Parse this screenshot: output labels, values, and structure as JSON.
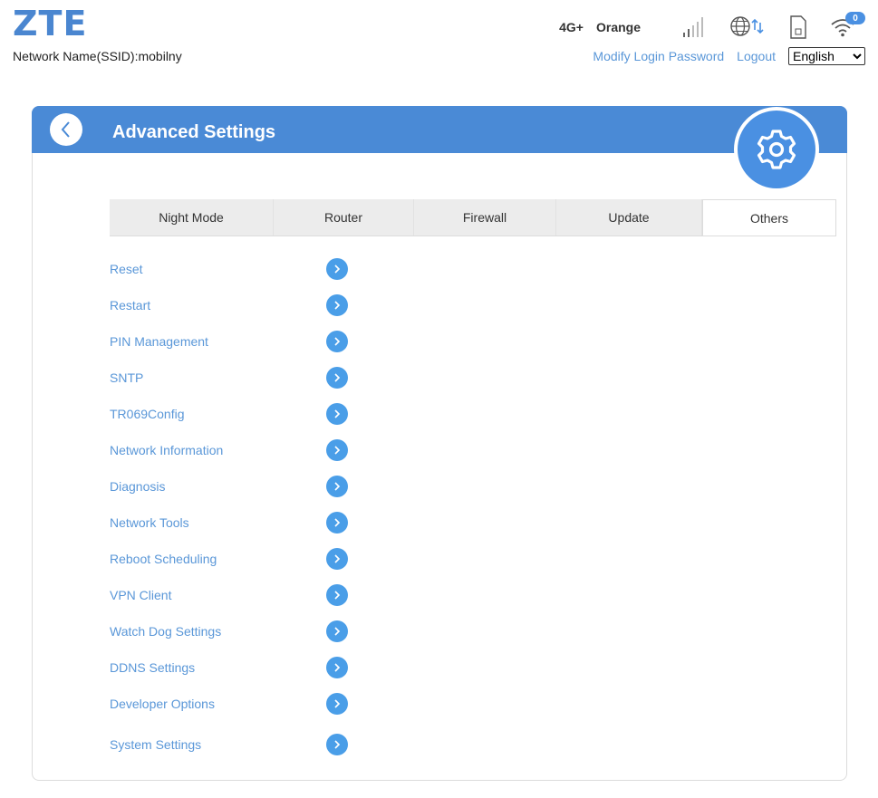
{
  "header": {
    "logo": "ZTE",
    "ssid": "Network Name(SSID):mobilny",
    "network_type": "4G+",
    "carrier": "Orange",
    "wifi_clients": "0",
    "modify_password": "Modify Login Password",
    "logout": "Logout",
    "language": "English"
  },
  "panel": {
    "title": "Advanced Settings"
  },
  "tabs": [
    {
      "label": "Night Mode"
    },
    {
      "label": "Router"
    },
    {
      "label": "Firewall"
    },
    {
      "label": "Update"
    },
    {
      "label": "Others"
    }
  ],
  "menu": [
    {
      "label": "Reset"
    },
    {
      "label": "Restart"
    },
    {
      "label": "PIN Management"
    },
    {
      "label": "SNTP"
    },
    {
      "label": "TR069Config"
    },
    {
      "label": "Network Information"
    },
    {
      "label": "Diagnosis"
    },
    {
      "label": "Network Tools"
    },
    {
      "label": "Reboot Scheduling"
    },
    {
      "label": "VPN Client"
    },
    {
      "label": "Watch Dog Settings"
    },
    {
      "label": "DDNS Settings"
    },
    {
      "label": "Developer Options"
    },
    {
      "label": "System Settings"
    }
  ],
  "colors": {
    "accent": "#4a8ad6",
    "link": "#5a97d8"
  }
}
